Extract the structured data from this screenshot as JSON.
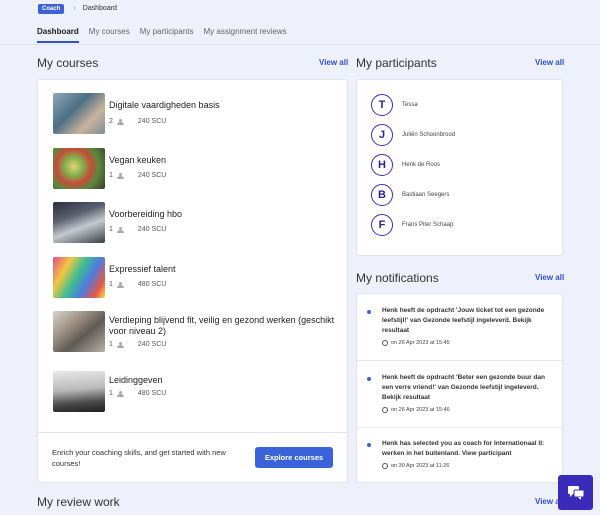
{
  "breadcrumb": {
    "badge": "Coach",
    "current": "Dashboard"
  },
  "tabs": [
    {
      "label": "Dashboard",
      "active": true
    },
    {
      "label": "My courses"
    },
    {
      "label": "My participants"
    },
    {
      "label": "My assignment reviews"
    }
  ],
  "courses_section": {
    "title": "My courses",
    "view_all": "View all"
  },
  "courses": [
    {
      "title": "Digitale vaardigheden basis",
      "participants": "2",
      "scu": "240 SCU",
      "thumb": "laptop-photo"
    },
    {
      "title": "Vegan keuken",
      "participants": "1",
      "scu": "240 SCU",
      "thumb": "food-bowl-photo"
    },
    {
      "title": "Voorbereiding hbo",
      "participants": "1",
      "scu": "240 SCU",
      "thumb": "study-photo"
    },
    {
      "title": "Expressief talent",
      "participants": "1",
      "scu": "480 SCU",
      "thumb": "colorful-paint-photo"
    },
    {
      "title": "Verdieping blijvend fit, veilig en gezond werken (geschikt voor niveau 2)",
      "participants": "1",
      "scu": "240 SCU",
      "thumb": "group-photo"
    },
    {
      "title": "Leidinggeven",
      "participants": "1",
      "scu": "480 SCU",
      "thumb": "stage-photo"
    }
  ],
  "cta": {
    "text": "Enrich your coaching skills, and get started with new courses!",
    "button": "Explore courses"
  },
  "participants_section": {
    "title": "My participants",
    "view_all": "View all"
  },
  "participants": [
    {
      "initial": "T",
      "name": "Tessa"
    },
    {
      "initial": "J",
      "name": "Juliën Schoonbrood"
    },
    {
      "initial": "H",
      "name": "Henk de Roos"
    },
    {
      "initial": "B",
      "name": "Bastiaan Seegers"
    },
    {
      "initial": "F",
      "name": "Frans Piter Schaap"
    }
  ],
  "notifications_section": {
    "title": "My notifications",
    "view_all": "View all"
  },
  "notifications": [
    {
      "text": "Henk heeft de opdracht 'Jouw ticket tot een gezonde leefstijl!' van Gezonde leefstijl ingeleverd. Bekijk resultaat",
      "date": "on 26 Apr 2023 at 15:45"
    },
    {
      "text": "Henk heeft de opdracht 'Beter een gezonde buur dan een verre vriend!' van Gezonde leefstijl ingeleverd. Bekijk resultaat",
      "date": "on 26 Apr 2023 at 15:46"
    },
    {
      "text": "Henk has selected you as coach for Internationaal II: werken in het buitenland. View participant",
      "date": "on 30 Apr 2023 at 11:26"
    }
  ],
  "review_section": {
    "title": "My review work",
    "view_all": "View all"
  },
  "colors": {
    "accent": "#3b63d9",
    "avatar": "#3a2bbb",
    "background": "#eef0fb"
  },
  "icons": {
    "chat": "chat-bubble-icon"
  }
}
